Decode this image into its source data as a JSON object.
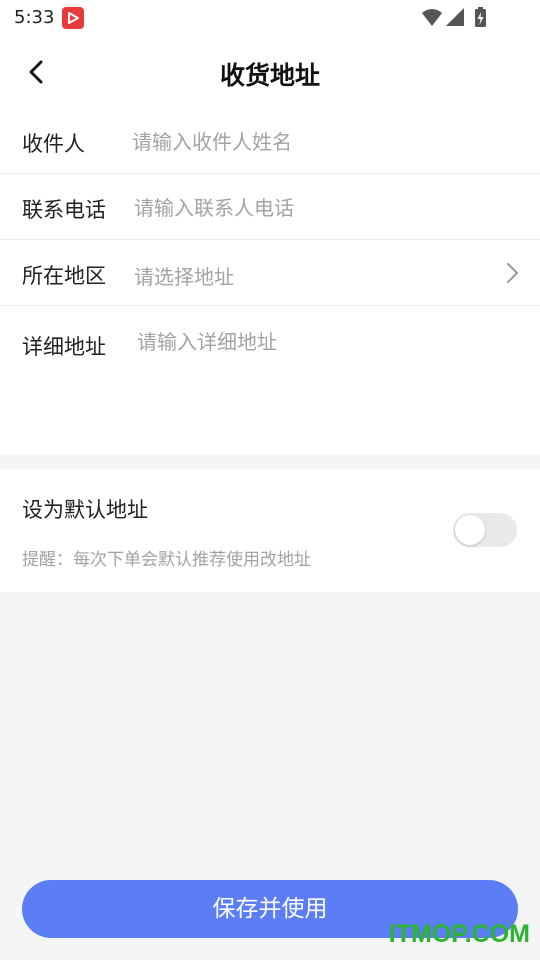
{
  "status_bar": {
    "time": "5:33",
    "icons": [
      "app-notification-icon",
      "wifi-icon",
      "signal-icon",
      "battery-charging-icon"
    ]
  },
  "header": {
    "title": "收货地址",
    "back_icon": "chevron-left-icon"
  },
  "form": {
    "recipient": {
      "label": "收件人",
      "placeholder": "请输入收件人姓名",
      "value": ""
    },
    "phone": {
      "label": "联系电话",
      "placeholder": "请输入联系人电话",
      "value": ""
    },
    "region": {
      "label": "所在地区",
      "placeholder": "请选择地址",
      "icon": "chevron-right-icon"
    },
    "detail": {
      "label": "详细地址",
      "placeholder": "请输入详细地址",
      "value": ""
    }
  },
  "default_address": {
    "title": "设为默认地址",
    "hint": "提醒：每次下单会默认推荐使用改地址",
    "enabled": false
  },
  "actions": {
    "save_label": "保存并使用"
  },
  "watermark": "ITMOP.COM",
  "colors": {
    "accent": "#5b7ef7",
    "background": "#f4f4f5",
    "placeholder": "#a3a3a3",
    "watermark": "#2bb52f"
  }
}
